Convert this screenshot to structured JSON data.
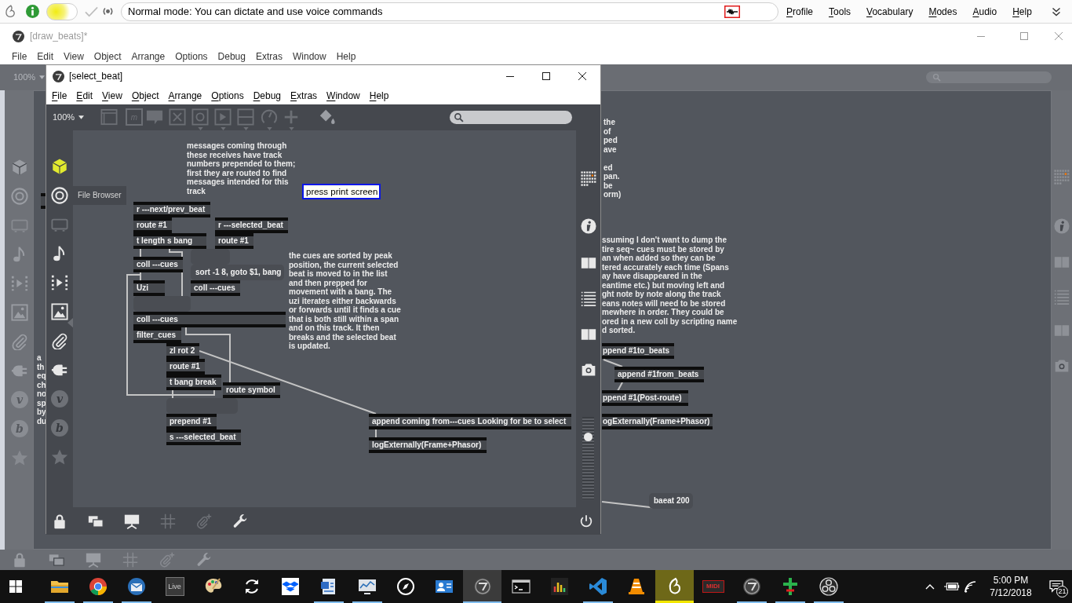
{
  "dictation_bar": {
    "microphone": {
      "on": true
    },
    "status": "Normal mode: You can dictate and use voice commands",
    "menu": [
      "Profile",
      "Tools",
      "Vocabulary",
      "Modes",
      "Audio",
      "Help"
    ]
  },
  "main_window": {
    "title": "[draw_beats]*",
    "focused": false,
    "menu": [
      "File",
      "Edit",
      "View",
      "Object",
      "Arrange",
      "Options",
      "Debug",
      "Extras",
      "Window",
      "Help"
    ],
    "zoom": "100%",
    "left_tools": [
      {
        "kind": "cube",
        "disabled": false
      },
      {
        "kind": "target",
        "disabled": false
      },
      {
        "kind": "monitor",
        "disabled": true
      },
      {
        "kind": "note",
        "disabled": false
      },
      {
        "kind": "sequence",
        "disabled": false
      },
      {
        "kind": "image",
        "disabled": false
      },
      {
        "kind": "clip",
        "disabled": false
      },
      {
        "kind": "plug",
        "disabled": false
      },
      {
        "kind": "letter",
        "label": "v",
        "disabled": true
      },
      {
        "kind": "letter",
        "label": "b",
        "disabled": true
      },
      {
        "kind": "star",
        "disabled": true
      }
    ],
    "right_tools": [
      {
        "kind": "grid"
      },
      {
        "kind": "info"
      },
      {
        "kind": "book"
      },
      {
        "kind": "list"
      },
      {
        "kind": "book"
      },
      {
        "kind": "camera"
      }
    ],
    "bottom_tools": [
      {
        "kind": "lock",
        "disabled": false
      },
      {
        "kind": "windows",
        "disabled": false
      },
      {
        "kind": "easel",
        "disabled": false
      },
      {
        "kind": "grid",
        "disabled": true
      },
      {
        "kind": "clipplus",
        "disabled": true
      },
      {
        "kind": "wrench",
        "disabled": false
      }
    ],
    "comments": [
      {
        "text": "the\nof\nped\nave\n\ned\npan.\nbe\norm)"
      },
      {
        "text": "ssuming I don't want to dump the\ntire seq~ cues must be stored by\nan when added so they can be\ntered accurately each time (Spans\nay have disappeared in the\neantime etc.) but moving left and\nght note by note along the track\neans notes will need to be stored\nmewhere in order. They could be\nored in a new coll by scripting name\nd sorted."
      },
      {
        "text": "a\nth\neq\nch\nno\nsp\nby\ndu"
      }
    ],
    "objects": [
      {
        "kind": "object",
        "text": "ppend #1to_beats"
      },
      {
        "kind": "object",
        "text": "append #1from_beats"
      },
      {
        "kind": "object",
        "text": "ppend #1(Post-route)"
      },
      {
        "kind": "object",
        "text": "ogExternally(Frame+Phasor)"
      },
      {
        "kind": "message",
        "text": "baeat 200"
      }
    ]
  },
  "patcher_window": {
    "title": "[select_beat]",
    "focused": true,
    "menu": [
      "File",
      "Edit",
      "View",
      "Object",
      "Arrange",
      "Options",
      "Debug",
      "Extras",
      "Window",
      "Help"
    ],
    "zoom": "100%",
    "toolbar": [
      {
        "kind": "presentation",
        "dropdown": false,
        "disabled": true
      },
      {
        "kind": "message",
        "label": "m",
        "dropdown": false,
        "disabled": true
      },
      {
        "kind": "comment",
        "dropdown": false,
        "disabled": true
      },
      {
        "kind": "button",
        "dropdown": false,
        "disabled": true
      },
      {
        "kind": "toggle",
        "dropdown": true,
        "disabled": true
      },
      {
        "kind": "play",
        "dropdown": true,
        "disabled": true
      },
      {
        "kind": "number",
        "dropdown": true,
        "disabled": true
      },
      {
        "kind": "dial",
        "dropdown": true,
        "disabled": true
      },
      {
        "kind": "plus",
        "dropdown": true,
        "disabled": true
      },
      {
        "kind": "bucket",
        "dropdown": false,
        "disabled": false
      }
    ],
    "left_tools": [
      {
        "kind": "cube",
        "disabled": false
      },
      {
        "kind": "target",
        "disabled": false
      },
      {
        "kind": "monitor",
        "disabled": true
      },
      {
        "kind": "note",
        "disabled": false
      },
      {
        "kind": "sequence",
        "disabled": false
      },
      {
        "kind": "image",
        "disabled": false
      },
      {
        "kind": "clip",
        "disabled": false
      },
      {
        "kind": "plug",
        "disabled": false
      },
      {
        "kind": "letter",
        "label": "v",
        "disabled": true
      },
      {
        "kind": "letter",
        "label": "b",
        "disabled": true
      },
      {
        "kind": "star",
        "disabled": true
      }
    ],
    "tooltip": "File Browser",
    "right_tools": [
      {
        "kind": "grid"
      },
      {
        "kind": "info"
      },
      {
        "kind": "book"
      },
      {
        "kind": "list"
      },
      {
        "kind": "book"
      },
      {
        "kind": "camera"
      }
    ],
    "volume": {
      "level": 0.76
    },
    "bottom_tools": [
      {
        "kind": "lock",
        "disabled": false
      },
      {
        "kind": "windows",
        "disabled": false
      },
      {
        "kind": "easel",
        "disabled": false
      },
      {
        "kind": "grid",
        "disabled": true
      },
      {
        "kind": "clipplus",
        "disabled": true
      },
      {
        "kind": "wrench",
        "disabled": false
      }
    ],
    "comments": [
      {
        "text": "messages coming through\nthese receives have track\nnumbers prepended to them;\nfirst they are routed to find\nmessages intended for this\ntrack"
      },
      {
        "text": "the cues are sorted by peak\nposition, the current selected\nbeat is moved to in the list\nand then prepped for\nmovement with a bang. The\nuzi iterates either backwards\nor forwards until it finds a cue\nthat is both still within a span\nand on this track. It then\nbreaks and the selected beat\nis updated."
      }
    ],
    "note": "press print screen",
    "objects": [
      {
        "kind": "object",
        "text": "r ---next/prev_beat"
      },
      {
        "kind": "object",
        "text": "route #1"
      },
      {
        "kind": "object",
        "text": "r ---selected_beat"
      },
      {
        "kind": "object",
        "text": "t length s bang"
      },
      {
        "kind": "object",
        "text": "route #1"
      },
      {
        "kind": "message"
      },
      {
        "kind": "object",
        "text": "coll ---cues"
      },
      {
        "kind": "message",
        "text": "sort -1 8, goto $1, bang"
      },
      {
        "kind": "object",
        "text": "Uzi"
      },
      {
        "kind": "object",
        "text": "coll ---cues"
      },
      {
        "kind": "message"
      },
      {
        "kind": "object",
        "text": "coll ---cues"
      },
      {
        "kind": "object",
        "text": "filter_cues"
      },
      {
        "kind": "object",
        "text": "zl rot 2"
      },
      {
        "kind": "object",
        "text": "route #1"
      },
      {
        "kind": "object",
        "text": "t bang break"
      },
      {
        "kind": "object",
        "text": "route symbol"
      },
      {
        "kind": "message"
      },
      {
        "kind": "object",
        "text": "prepend #1"
      },
      {
        "kind": "object",
        "text": "s ---selected_beat"
      },
      {
        "kind": "object",
        "text": "append coming from---cues Looking for be to select"
      },
      {
        "kind": "object",
        "text": "logExternally(Frame+Phasor)"
      }
    ]
  },
  "taskbar": {
    "apps": [
      {
        "kind": "explorer",
        "running": true,
        "active": false,
        "flashing": false
      },
      {
        "kind": "chrome",
        "running": true,
        "active": false,
        "flashing": false
      },
      {
        "kind": "thunderbird",
        "running": true,
        "active": false,
        "flashing": false
      },
      {
        "kind": "live",
        "label": "Live",
        "running": false,
        "active": false,
        "flashing": false
      },
      {
        "kind": "palette",
        "running": false,
        "active": false,
        "flashing": false
      },
      {
        "kind": "sync",
        "running": false,
        "active": false,
        "flashing": false
      },
      {
        "kind": "dropbox",
        "running": false,
        "active": false,
        "flashing": false
      },
      {
        "kind": "document",
        "running": true,
        "active": false,
        "flashing": false
      },
      {
        "kind": "monitor",
        "running": true,
        "active": false,
        "flashing": false
      },
      {
        "kind": "compass",
        "running": false,
        "active": false,
        "flashing": false
      },
      {
        "kind": "card",
        "running": false,
        "active": false,
        "flashing": false
      },
      {
        "kind": "max",
        "running": true,
        "active": true,
        "flashing": false
      },
      {
        "kind": "terminal",
        "running": false,
        "active": false,
        "flashing": false
      },
      {
        "kind": "bars",
        "running": false,
        "active": false,
        "flashing": false
      },
      {
        "kind": "vscode",
        "running": true,
        "active": false,
        "flashing": false
      },
      {
        "kind": "cone",
        "running": false,
        "active": false,
        "flashing": false
      },
      {
        "kind": "flame",
        "running": true,
        "active": false,
        "flashing": true
      },
      {
        "kind": "midi",
        "label": "MIDI",
        "running": false,
        "active": false,
        "flashing": false
      },
      {
        "kind": "max",
        "running": true,
        "active": false,
        "flashing": false
      },
      {
        "kind": "cross",
        "running": true,
        "active": false,
        "flashing": false
      },
      {
        "kind": "obs",
        "running": true,
        "active": false,
        "flashing": false
      }
    ],
    "time": "5:00 PM",
    "date": "7/12/2018",
    "notifications": "21"
  }
}
